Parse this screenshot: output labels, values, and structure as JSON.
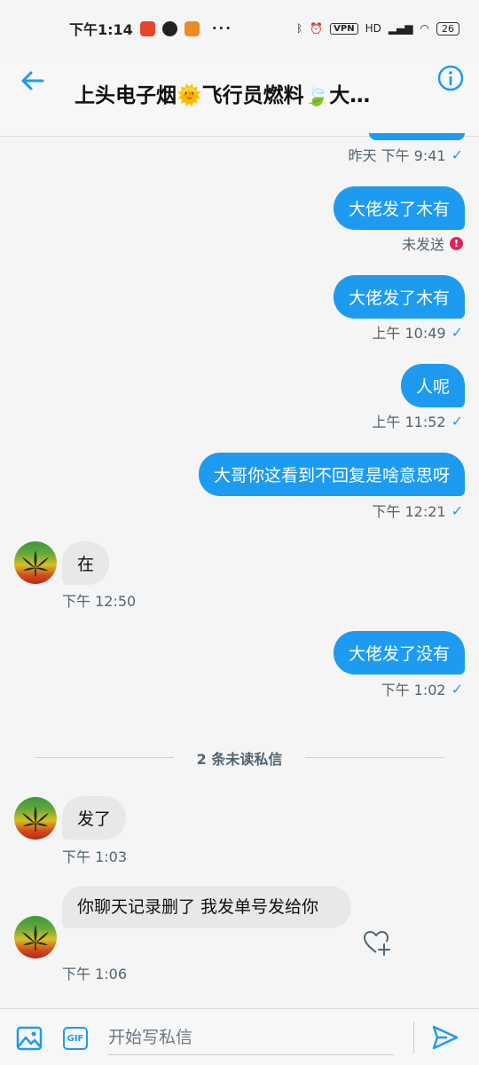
{
  "status_bar": {
    "time": "下午1:14",
    "dots": "···",
    "vpn": "VPN",
    "network": "HD",
    "battery": "26"
  },
  "header": {
    "title": "上头电子烟🌞飞行员燃料🍃大…"
  },
  "messages": {
    "m0_meta": "昨天 下午 9:41",
    "m1_text": "大佬发了木有",
    "m1_meta": "未发送",
    "m2_text": "大佬发了木有",
    "m2_meta": "上午 10:49",
    "m3_text": "人呢",
    "m3_meta": "上午 11:52",
    "m4_text": "大哥你这看到不回复是啥意思呀",
    "m4_meta": "下午 12:21",
    "m5_text": "在",
    "m5_meta": "下午 12:50",
    "m6_text": "大佬发了没有",
    "m6_meta": "下午 1:02",
    "unread_divider": "2 条未读私信",
    "m7_text": "发了",
    "m7_meta": "下午 1:03",
    "m8_text": "你聊天记录删了 我发单号发给你",
    "m8_meta": "下午 1:06",
    "check_glyph": "✓",
    "error_glyph": "!"
  },
  "composer": {
    "gif_label": "GIF",
    "placeholder": "开始写私信"
  },
  "colors": {
    "accent": "#1d9bf0",
    "incoming_bubble": "#e6e8ea",
    "error": "#e0245e"
  },
  "icons": [
    "back-arrow-icon",
    "info-icon",
    "image-icon",
    "gif-icon",
    "send-icon",
    "heart-plus-icon",
    "check-icon",
    "error-icon",
    "cannabis-avatar"
  ]
}
